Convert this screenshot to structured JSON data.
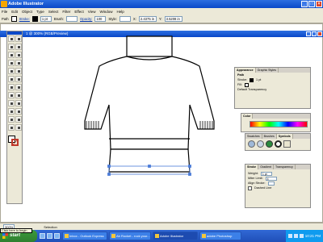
{
  "window": {
    "title": "Adobe Illustrator"
  },
  "menu": [
    "File",
    "Edit",
    "Object",
    "Type",
    "Select",
    "Filter",
    "Effect",
    "View",
    "Window",
    "Help"
  ],
  "control_bar": {
    "path_label": "Path",
    "stroke_label": "Stroke:",
    "stroke_value": "1 pt",
    "brush_label": "Brush:",
    "opacity_label": "Opacity:",
    "opacity_value": "100",
    "style_label": "Style:",
    "x_label": "X:",
    "x_value": "2.4375 in",
    "y_label": "Y:",
    "y_value": "3.5208 in"
  },
  "document": {
    "title": "1 @ 300% (RGB/Preview)"
  },
  "appearance_panel": {
    "tabs": [
      "Appearance",
      "Graphic Styles"
    ],
    "rows": [
      "Path",
      "Stroke:",
      "Fill:",
      "Default Transparency"
    ],
    "stroke_weight": "1 pt"
  },
  "color_panel": {
    "tabs": [
      "Color"
    ],
    "swatch_tabs": [
      "Swatches",
      "Brushes",
      "Symbols"
    ]
  },
  "stroke_panel": {
    "tabs": [
      "Stroke",
      "Gradient",
      "Transparency"
    ],
    "weight_label": "Weight:",
    "weight_value": "1 pt",
    "miter_label": "Miter Limit:",
    "miter_value": "4",
    "align_label": "Align Stroke:",
    "dashed_label": "Dashed Line"
  },
  "status_bar": {
    "zoom": "300%",
    "selection": "Selection"
  },
  "taskbar": {
    "start": "start",
    "tasks": [
      "Inbox - Outlook Express",
      "Ab Rocket - rock your...",
      "Adobe Illustrator",
      "adobe Photoshop"
    ],
    "clock": "10:21 PM",
    "tooltip": "Click here to begin"
  },
  "colors": {
    "title_blue": "#0a48c8",
    "chrome": "#ece9d8",
    "start_green": "#2f7f2f",
    "selection_blue": "#4a7bd8"
  }
}
